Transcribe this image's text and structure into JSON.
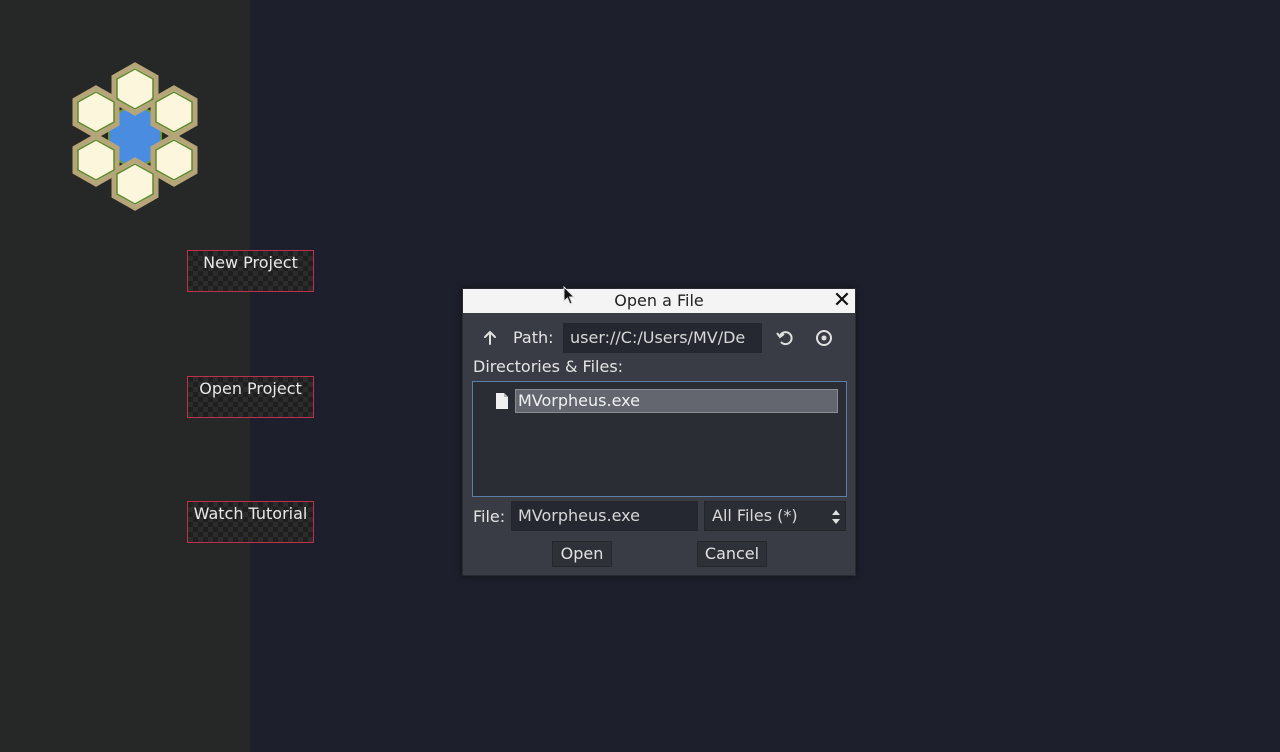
{
  "sidebar": {
    "buttons": [
      {
        "label": "New Project"
      },
      {
        "label": "Open Project"
      },
      {
        "label": "Watch Tutorial"
      }
    ]
  },
  "dialog": {
    "title": "Open a File",
    "path_label": "Path:",
    "path_value": "user://C:/Users/MV/De",
    "dir_label": "Directories & Files:",
    "files": [
      {
        "name": "MVorpheus.exe",
        "selected": true
      }
    ],
    "file_label": "File:",
    "file_value": "MVorpheus.exe",
    "filter_value": "All Files (*)",
    "open_label": "Open",
    "cancel_label": "Cancel"
  },
  "colors": {
    "sidebar_bg": "#262827",
    "main_bg": "#1e1f2c",
    "button_border": "#c0304a",
    "dialog_bg": "#3a3c45",
    "list_border": "#5a7fa8"
  },
  "icons": [
    "up-arrow-icon",
    "refresh-icon",
    "eye-icon",
    "file-icon",
    "close-icon",
    "select-arrows-icon",
    "mouse-cursor-icon"
  ]
}
